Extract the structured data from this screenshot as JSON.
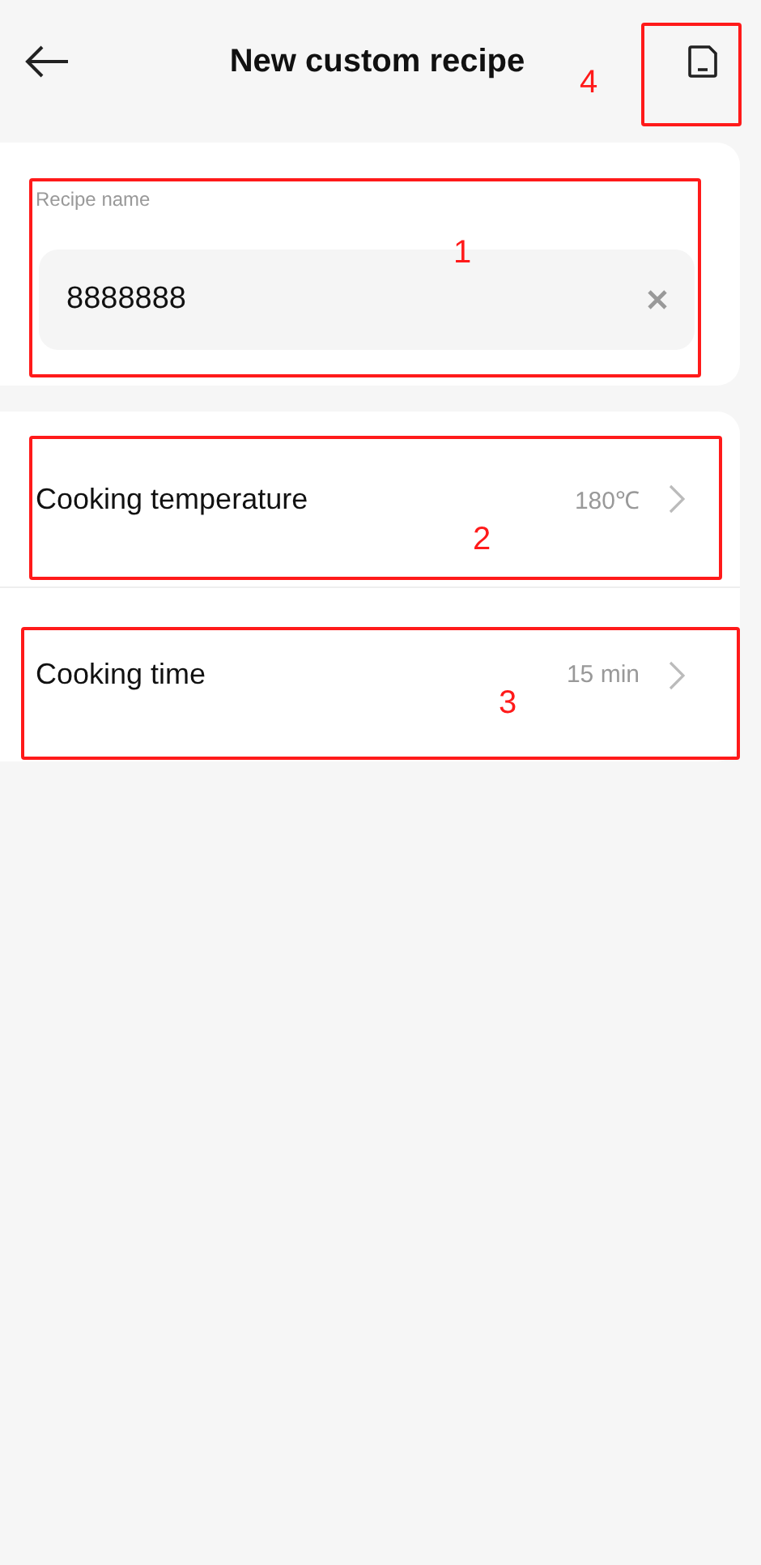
{
  "header": {
    "title": "New custom recipe"
  },
  "recipe_name": {
    "label": "Recipe name",
    "value": "8888888"
  },
  "settings": [
    {
      "label": "Cooking temperature",
      "value": "180℃"
    },
    {
      "label": "Cooking time",
      "value": "15 min"
    }
  ],
  "annotations": [
    {
      "label": "1"
    },
    {
      "label": "2"
    },
    {
      "label": "3"
    },
    {
      "label": "4"
    }
  ]
}
